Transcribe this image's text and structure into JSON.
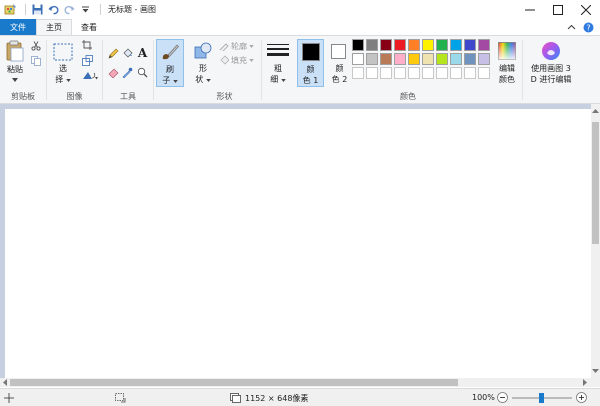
{
  "title_bar": {
    "document_name": "无标题",
    "separator": "-",
    "app_name": "画图"
  },
  "tabs": [
    {
      "label": "文件"
    },
    {
      "label": "主页"
    },
    {
      "label": "查看"
    }
  ],
  "clipboard": {
    "paste_label": "粘贴",
    "group_label": "剪贴板"
  },
  "image": {
    "select_label_1": "选",
    "select_label_2": "择",
    "group_label": "图像"
  },
  "tools": {
    "group_label": "工具",
    "text_tool": "A"
  },
  "brushes": {
    "label_1": "刷",
    "label_2": "子"
  },
  "shapes": {
    "label_1": "形",
    "label_2": "状",
    "outline_label": "轮廓",
    "fill_label": "填充",
    "group_label": "形状"
  },
  "size": {
    "label_1": "粗",
    "label_2": "细"
  },
  "colors": {
    "color1_label_1": "颜",
    "color1_label_2": "色 1",
    "color2_label_1": "颜",
    "color2_label_2": "色 2",
    "edit_colors_label_1": "编辑",
    "edit_colors_label_2": "颜色",
    "group_label": "颜色",
    "color1_value": "#000000",
    "color2_value": "#ffffff",
    "palette_row1": [
      "#000000",
      "#7f7f7f",
      "#880015",
      "#ed1c24",
      "#ff7f27",
      "#fff200",
      "#22b14c",
      "#00a2e8",
      "#3f48cc",
      "#a349a4"
    ],
    "palette_row2": [
      "#ffffff",
      "#c3c3c3",
      "#b97a57",
      "#ffaec9",
      "#ffc90e",
      "#efe4b0",
      "#b5e61d",
      "#99d9ea",
      "#7092be",
      "#c8bfe7"
    ],
    "palette_row3": [
      "#ffffff",
      "#ffffff",
      "#ffffff",
      "#ffffff",
      "#ffffff",
      "#ffffff",
      "#ffffff",
      "#ffffff",
      "#ffffff",
      "#ffffff"
    ]
  },
  "paint3d": {
    "label_1": "使用画图 3",
    "label_2": "D 进行编辑"
  },
  "status": {
    "image_size": "1152 × 648像素",
    "zoom": "100%"
  },
  "theme": {
    "file_tab_bg": "#1979ca",
    "canvas_bg": "#c7d0e0",
    "ribbon_bg": "#f5f6f7",
    "selected_tool_bg": "#c9e0f7"
  }
}
